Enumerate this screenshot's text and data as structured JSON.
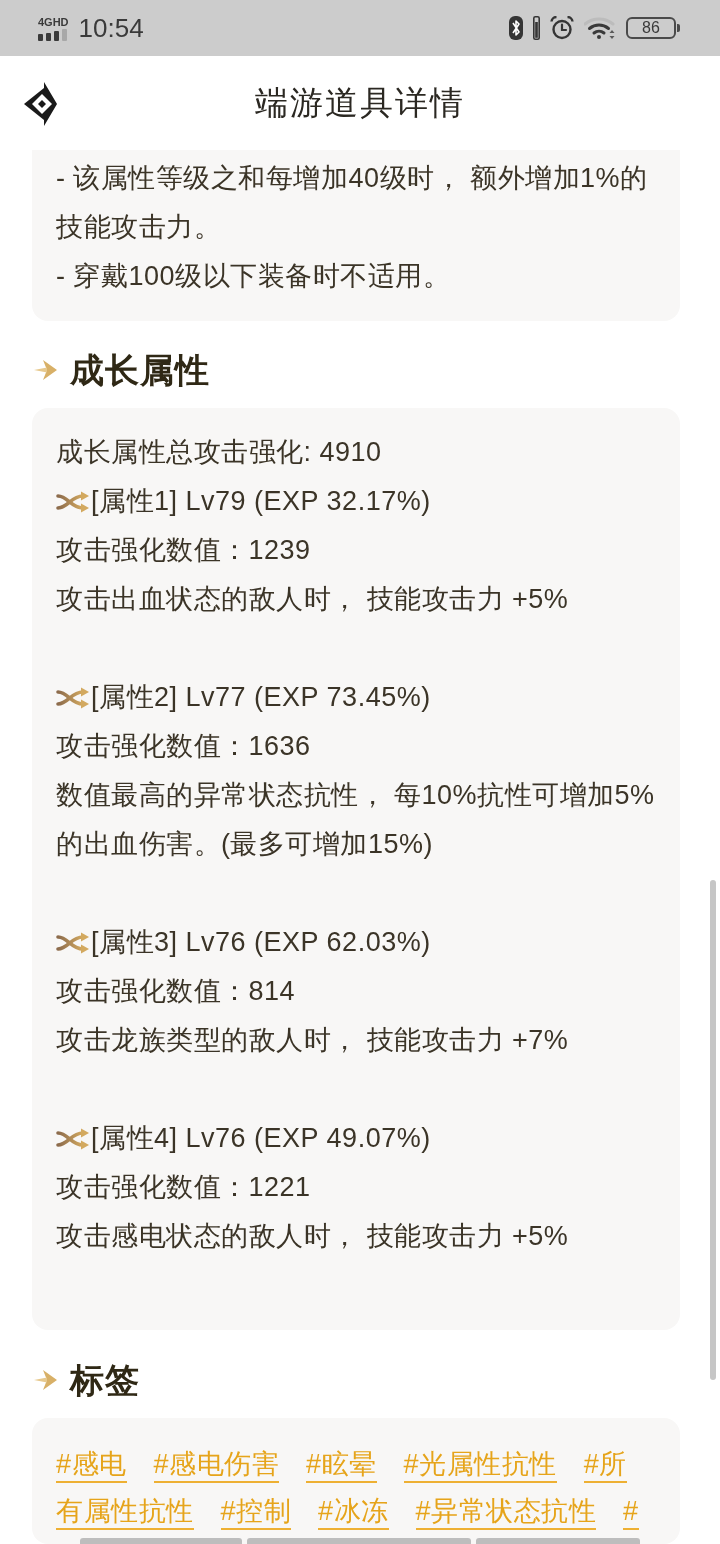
{
  "status_bar": {
    "network": "4GHD",
    "time": "10:54",
    "battery": "86"
  },
  "header": {
    "title": "端游道具详情"
  },
  "notes_card": {
    "lines": [
      "- 该属性等级之和每增加40级时， 额外增加1%的技能攻击力。",
      "- 穿戴100级以下装备时不适用。"
    ]
  },
  "growth": {
    "title": "成长属性",
    "summary": "成长属性总攻击强化: 4910",
    "attributes": [
      {
        "header": "[属性1] Lv79 (EXP 32.17%)",
        "value": "攻击强化数值：1239",
        "effect": "攻击出血状态的敌人时， 技能攻击力 +5%"
      },
      {
        "header": "[属性2] Lv77 (EXP 73.45%)",
        "value": "攻击强化数值：1636",
        "effect": "数值最高的异常状态抗性， 每10%抗性可增加5%的出血伤害。(最多可增加15%)"
      },
      {
        "header": "[属性3] Lv76 (EXP 62.03%)",
        "value": "攻击强化数值：814",
        "effect": "攻击龙族类型的敌人时， 技能攻击力 +7%"
      },
      {
        "header": "[属性4] Lv76 (EXP 49.07%)",
        "value": "攻击强化数值：1221",
        "effect": "攻击感电状态的敌人时， 技能攻击力 +5%"
      }
    ]
  },
  "tags": {
    "title": "标签",
    "rows": [
      [
        "#感电",
        "#感电伤害",
        "#眩晕",
        "#光属性抗性",
        "#所"
      ],
      [
        "有属性抗性",
        "#控制",
        "#冰冻",
        "#异常状态抗性",
        "#"
      ]
    ]
  }
}
